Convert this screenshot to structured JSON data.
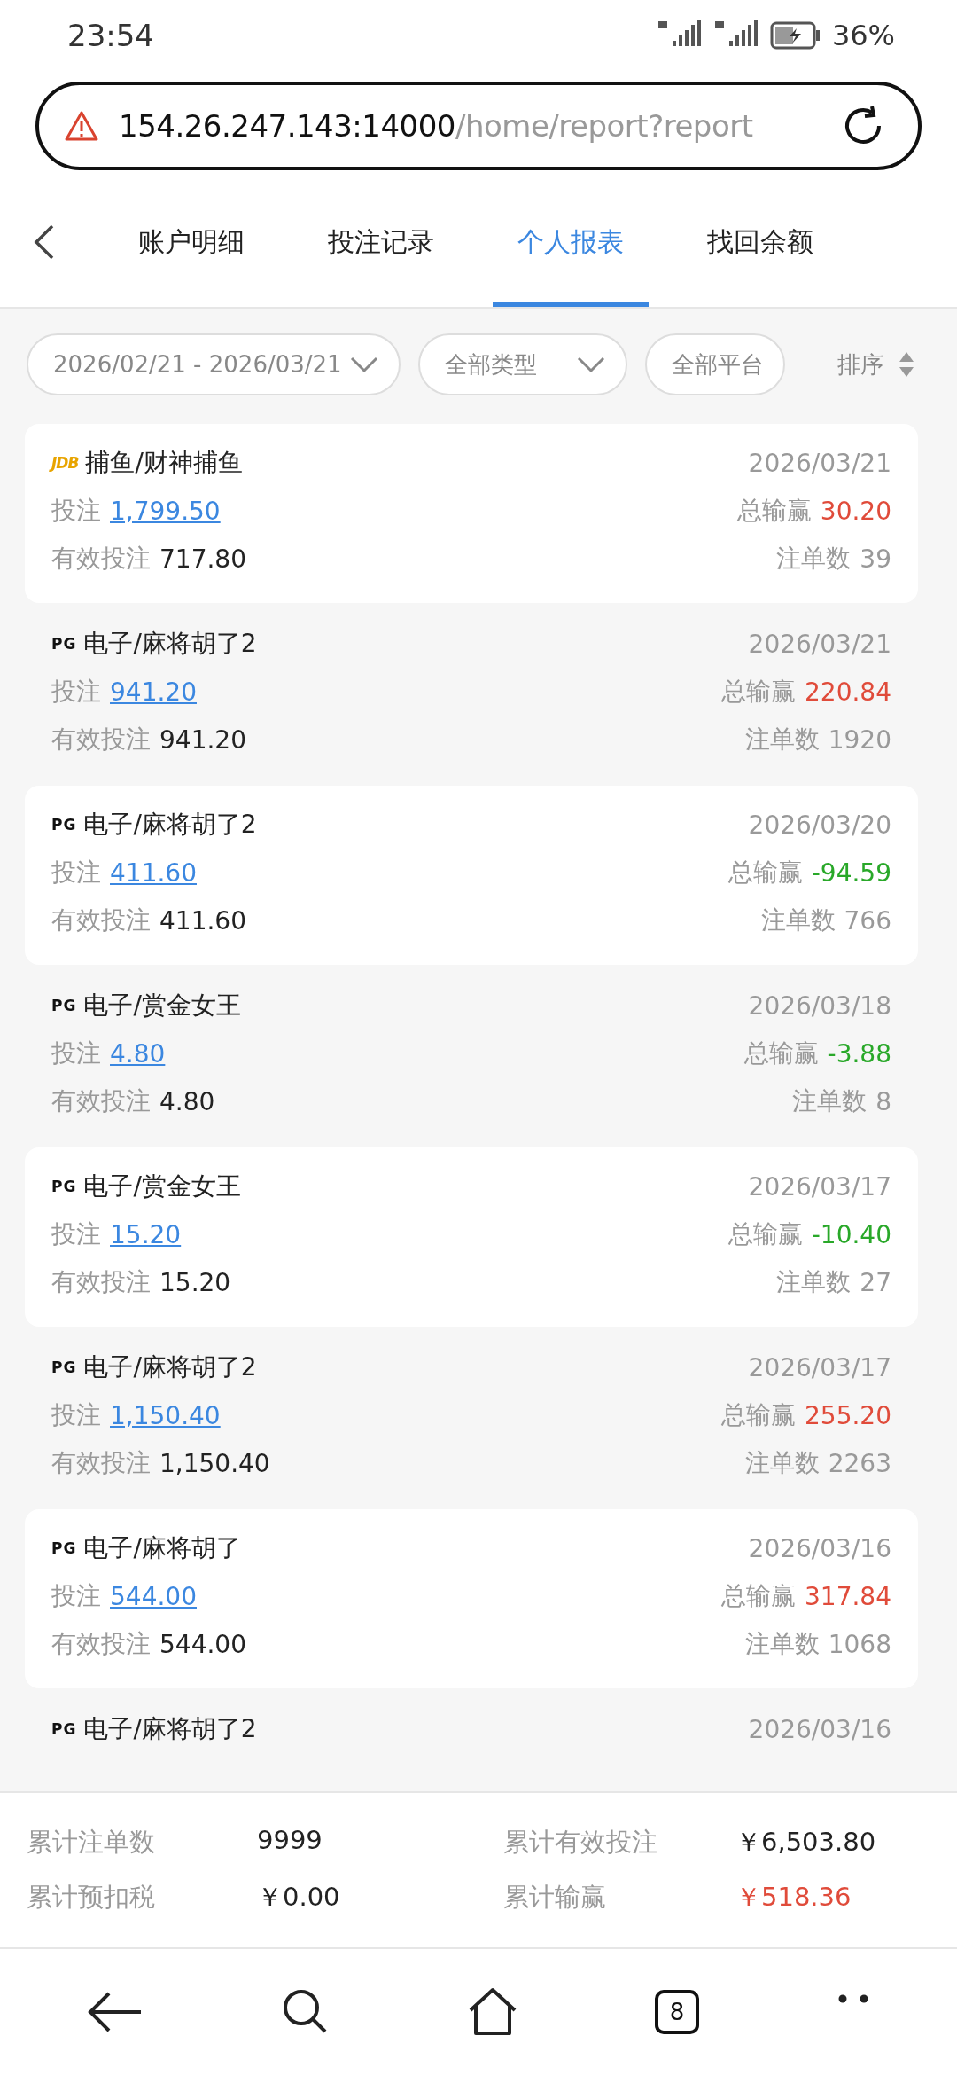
{
  "status_bar": {
    "time": "23:54",
    "battery": "36%"
  },
  "address_bar": {
    "host": "154.26.247.143:14000",
    "path": "/home/report?report"
  },
  "tabs": [
    {
      "label": "账户明细",
      "selected": false
    },
    {
      "label": "投注记录",
      "selected": false
    },
    {
      "label": "个人报表",
      "selected": true
    },
    {
      "label": "找回余额",
      "selected": false
    }
  ],
  "filters": {
    "date_range": "2026/02/21 - 2026/03/21",
    "type": "全部类型",
    "platform": "全部平台",
    "sort": "排序"
  },
  "records": [
    {
      "provider": "JDB",
      "game": "捕鱼/财神捕鱼",
      "date": "2026/03/21",
      "bet_label": "投注",
      "bet": "1,799.50",
      "result_label": "总输赢",
      "result": "30.20",
      "color": "#e04b3a",
      "valid_label": "有效投注",
      "valid": "717.80",
      "count_label": "注单数",
      "count": "39"
    },
    {
      "provider": "PG",
      "game": "电子/麻将胡了2",
      "date": "2026/03/21",
      "bet_label": "投注",
      "bet": "941.20",
      "result_label": "总输赢",
      "result": "220.84",
      "color": "#e04b3a",
      "valid_label": "有效投注",
      "valid": "941.20",
      "count_label": "注单数",
      "count": "1920"
    },
    {
      "provider": "PG",
      "game": "电子/麻将胡了2",
      "date": "2026/03/20",
      "bet_label": "投注",
      "bet": "411.60",
      "result_label": "总输赢",
      "result": "-94.59",
      "color": "#29a829",
      "valid_label": "有效投注",
      "valid": "411.60",
      "count_label": "注单数",
      "count": "766"
    },
    {
      "provider": "PG",
      "game": "电子/赏金女王",
      "date": "2026/03/18",
      "bet_label": "投注",
      "bet": "4.80",
      "result_label": "总输赢",
      "result": "-3.88",
      "color": "#29a829",
      "valid_label": "有效投注",
      "valid": "4.80",
      "count_label": "注单数",
      "count": "8"
    },
    {
      "provider": "PG",
      "game": "电子/赏金女王",
      "date": "2026/03/17",
      "bet_label": "投注",
      "bet": "15.20",
      "result_label": "总输赢",
      "result": "-10.40",
      "color": "#29a829",
      "valid_label": "有效投注",
      "valid": "15.20",
      "count_label": "注单数",
      "count": "27"
    },
    {
      "provider": "PG",
      "game": "电子/麻将胡了2",
      "date": "2026/03/17",
      "bet_label": "投注",
      "bet": "1,150.40",
      "result_label": "总输赢",
      "result": "255.20",
      "color": "#e04b3a",
      "valid_label": "有效投注",
      "valid": "1,150.40",
      "count_label": "注单数",
      "count": "2263"
    },
    {
      "provider": "PG",
      "game": "电子/麻将胡了",
      "date": "2026/03/16",
      "bet_label": "投注",
      "bet": "544.00",
      "result_label": "总输赢",
      "result": "317.84",
      "color": "#e04b3a",
      "valid_label": "有效投注",
      "valid": "544.00",
      "count_label": "注单数",
      "count": "1068"
    },
    {
      "provider": "PG",
      "game": "电子/麻将胡了2",
      "date": "2026/03/16"
    }
  ],
  "summary": [
    {
      "label": "累计注单数",
      "value": "9999",
      "color": "#222222"
    },
    {
      "label": "累计有效投注",
      "value": "￥6,503.80",
      "color": "#222222"
    },
    {
      "label": "累计预扣税",
      "value": "￥0.00",
      "color": "#222222"
    },
    {
      "label": "累计输赢",
      "value": "￥518.36",
      "color": "#e04b3a"
    }
  ],
  "browser_nav": {
    "tab_count": "8"
  }
}
